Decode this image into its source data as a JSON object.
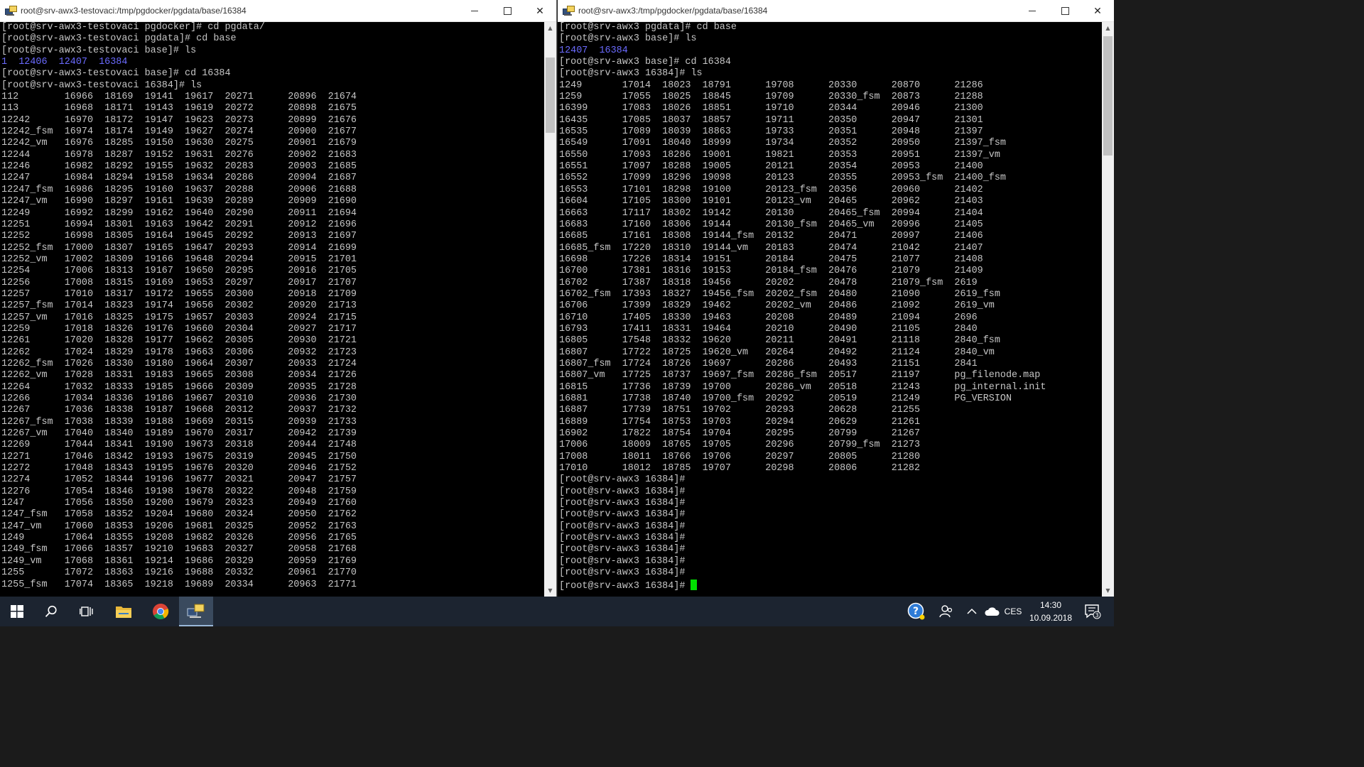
{
  "left_window": {
    "title": "root@srv-awx3-testovaci:/tmp/pgdocker/pgdata/base/16384",
    "lines": [
      "[root@srv-awx3-testovaci pgdocker]# cd pgdata/",
      "[root@srv-awx3-testovaci pgdata]# cd base",
      "[root@srv-awx3-testovaci base]# ls",
      "1  12406  12407  16384",
      "[root@srv-awx3-testovaci base]# cd 16384",
      "[root@srv-awx3-testovaci 16384]# ls",
      "112        16966  18169  19141  19617  20271      20896  21674",
      "113        16968  18171  19143  19619  20272      20898  21675",
      "12242      16970  18172  19147  19623  20273      20899  21676",
      "12242_fsm  16974  18174  19149  19627  20274      20900  21677",
      "12242_vm   16976  18285  19150  19630  20275      20901  21679",
      "12244      16978  18287  19152  19631  20276      20902  21683",
      "12246      16982  18292  19155  19632  20283      20903  21685",
      "12247      16984  18294  19158  19634  20286      20904  21687",
      "12247_fsm  16986  18295  19160  19637  20288      20906  21688",
      "12247_vm   16990  18297  19161  19639  20289      20909  21690",
      "12249      16992  18299  19162  19640  20290      20911  21694",
      "12251      16994  18301  19163  19642  20291      20912  21696",
      "12252      16998  18305  19164  19645  20292      20913  21697",
      "12252_fsm  17000  18307  19165  19647  20293      20914  21699",
      "12252_vm   17002  18309  19166  19648  20294      20915  21701",
      "12254      17006  18313  19167  19650  20295      20916  21705",
      "12256      17008  18315  19169  19653  20297      20917  21707",
      "12257      17010  18317  19172  19655  20300      20918  21709",
      "12257_fsm  17014  18323  19174  19656  20302      20920  21713",
      "12257_vm   17016  18325  19175  19657  20303      20924  21715",
      "12259      17018  18326  19176  19660  20304      20927  21717",
      "12261      17020  18328  19177  19662  20305      20930  21721",
      "12262      17024  18329  19178  19663  20306      20932  21723",
      "12262_fsm  17026  18330  19180  19664  20307      20933  21724",
      "12262_vm   17028  18331  19183  19665  20308      20934  21726",
      "12264      17032  18333  19185  19666  20309      20935  21728",
      "12266      17034  18336  19186  19667  20310      20936  21730",
      "12267      17036  18338  19187  19668  20312      20937  21732",
      "12267_fsm  17038  18339  19188  19669  20315      20939  21733",
      "12267_vm   17040  18340  19189  19670  20317      20942  21739",
      "12269      17044  18341  19190  19673  20318      20944  21748",
      "12271      17046  18342  19193  19675  20319      20945  21750",
      "12272      17048  18343  19195  19676  20320      20946  21752",
      "12274      17052  18344  19196  19677  20321      20947  21757",
      "12276      17054  18346  19198  19678  20322      20948  21759",
      "1247       17056  18350  19200  19679  20323      20949  21760",
      "1247_fsm   17058  18352  19204  19680  20324      20950  21762",
      "1247_vm    17060  18353  19206  19681  20325      20952  21763",
      "1249       17064  18355  19208  19682  20326      20956  21765",
      "1249_fsm   17066  18357  19210  19683  20327      20958  21768",
      "1249_vm    17068  18361  19214  19686  20329      20959  21769",
      "1255       17072  18363  19216  19688  20332      20961  21770",
      "1255_fsm   17074  18365  19218  19689  20334      20963  21771"
    ]
  },
  "right_window": {
    "title": "root@srv-awx3:/tmp/pgdocker/pgdata/base/16384",
    "lines": [
      "[root@srv-awx3 pgdata]# cd base",
      "[root@srv-awx3 base]# ls",
      "12407  16384",
      "[root@srv-awx3 base]# cd 16384",
      "[root@srv-awx3 16384]# ls",
      "1249       17014  18023  18791      19708      20330      20870      21286",
      "1259       17055  18025  18845      19709      20330_fsm  20873      21288",
      "16399      17083  18026  18851      19710      20344      20946      21300",
      "16435      17085  18037  18857      19711      20350      20947      21301",
      "16535      17089  18039  18863      19733      20351      20948      21397",
      "16549      17091  18040  18999      19734      20352      20950      21397_fsm",
      "16550      17093  18286  19001      19821      20353      20951      21397_vm",
      "16551      17097  18288  19005      20121      20354      20953      21400",
      "16552      17099  18296  19098      20123      20355      20953_fsm  21400_fsm",
      "16553      17101  18298  19100      20123_fsm  20356      20960      21402",
      "16604      17105  18300  19101      20123_vm   20465      20962      21403",
      "16663      17117  18302  19142      20130      20465_fsm  20994      21404",
      "16683      17160  18306  19144      20130_fsm  20465_vm   20996      21405",
      "16685      17161  18308  19144_fsm  20132      20471      20997      21406",
      "16685_fsm  17220  18310  19144_vm   20183      20474      21042      21407",
      "16698      17226  18314  19151      20184      20475      21077      21408",
      "16700      17381  18316  19153      20184_fsm  20476      21079      21409",
      "16702      17387  18318  19456      20202      20478      21079_fsm  2619",
      "16702_fsm  17393  18327  19456_fsm  20202_fsm  20480      21090      2619_fsm",
      "16706      17399  18329  19462      20202_vm   20486      21092      2619_vm",
      "16710      17405  18330  19463      20208      20489      21094      2696",
      "16793      17411  18331  19464      20210      20490      21105      2840",
      "16805      17548  18332  19620      20211      20491      21118      2840_fsm",
      "16807      17722  18725  19620_vm   20264      20492      21124      2840_vm",
      "16807_fsm  17724  18726  19697      20286      20493      21151      2841",
      "16807_vm   17725  18737  19697_fsm  20286_fsm  20517      21197      pg_filenode.map",
      "16815      17736  18739  19700      20286_vm   20518      21243      pg_internal.init",
      "16881      17738  18740  19700_fsm  20292      20519      21249      PG_VERSION",
      "16887      17739  18751  19702      20293      20628      21255",
      "16889      17754  18753  19703      20294      20629      21261",
      "16902      17822  18754  19704      20295      20799      21267",
      "17006      18009  18765  19705      20296      20799_fsm  21273",
      "17008      18011  18766  19706      20297      20805      21280",
      "17010      18012  18785  19707      20298      20806      21282",
      "[root@srv-awx3 16384]#",
      "[root@srv-awx3 16384]#",
      "[root@srv-awx3 16384]#",
      "[root@srv-awx3 16384]#",
      "[root@srv-awx3 16384]#",
      "[root@srv-awx3 16384]#",
      "[root@srv-awx3 16384]#",
      "[root@srv-awx3 16384]#",
      "[root@srv-awx3 16384]#",
      "[root@srv-awx3 16384]# "
    ]
  },
  "taskbar": {
    "icons": [
      "windows-start-icon",
      "search-icon",
      "task-view-icon",
      "file-explorer-icon",
      "chrome-icon",
      "putty-icon"
    ],
    "language": "CES",
    "time": "14:30",
    "date": "10.09.2018",
    "notification_count": "3"
  },
  "colors": {
    "terminal_bg": "#000000",
    "terminal_fg": "#c6c6c6",
    "directory_blue": "#6b6bff",
    "cursor_green": "#00e000",
    "taskbar_bg": "#1c2430"
  }
}
